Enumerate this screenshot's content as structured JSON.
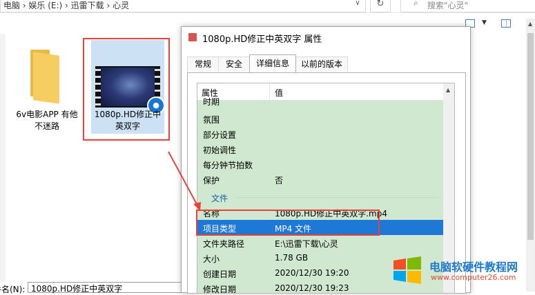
{
  "explorer": {
    "address_text": "电脑 › 娱乐 (E:) › 迅雷下载 › 心灵",
    "search_placeholder": "搜索\"心灵\"",
    "files": [
      {
        "label": "6v电影APP 有他不迷路",
        "type": "folder"
      },
      {
        "label": "1080p.HD修正中英双字",
        "type": "video"
      }
    ],
    "filename_label": "文件名(N):",
    "filename_value": "1080p.HD修正中英双字"
  },
  "dialog": {
    "title": "1080p.HD修正中英双字 属性",
    "tabs": [
      {
        "label": "常规",
        "active": false
      },
      {
        "label": "安全",
        "active": false
      },
      {
        "label": "详细信息",
        "active": true
      },
      {
        "label": "以前的版本",
        "active": false
      }
    ],
    "columns": {
      "property": "属性",
      "value": "值"
    },
    "rows": [
      {
        "k": "时期",
        "v": ""
      },
      {
        "k": "氛围",
        "v": ""
      },
      {
        "k": "部分设置",
        "v": ""
      },
      {
        "k": "初始调性",
        "v": ""
      },
      {
        "k": "每分钟节拍数",
        "v": ""
      },
      {
        "k": "保护",
        "v": "否"
      },
      {
        "k": "文件",
        "v": "",
        "group": true
      },
      {
        "k": "名称",
        "v": "1080p.HD修正中英双字.mp4"
      },
      {
        "k": "项目类型",
        "v": "MP4 文件",
        "selected": true
      },
      {
        "k": "文件夹路径",
        "v": "E:\\迅雷下载\\心灵"
      },
      {
        "k": "大小",
        "v": "1.78 GB"
      },
      {
        "k": "创建日期",
        "v": "2020/12/30 19:20"
      },
      {
        "k": "修改日期",
        "v": "2020/12/30 19:23"
      }
    ]
  },
  "watermark": {
    "title": "电脑软硬件教程网",
    "url": "www.computer26.com"
  },
  "colors": {
    "selection": "#1e78d6",
    "list_bg": "#cfe8cf",
    "highlight_red": "#e8403a",
    "group_text": "#1a5fb4"
  }
}
